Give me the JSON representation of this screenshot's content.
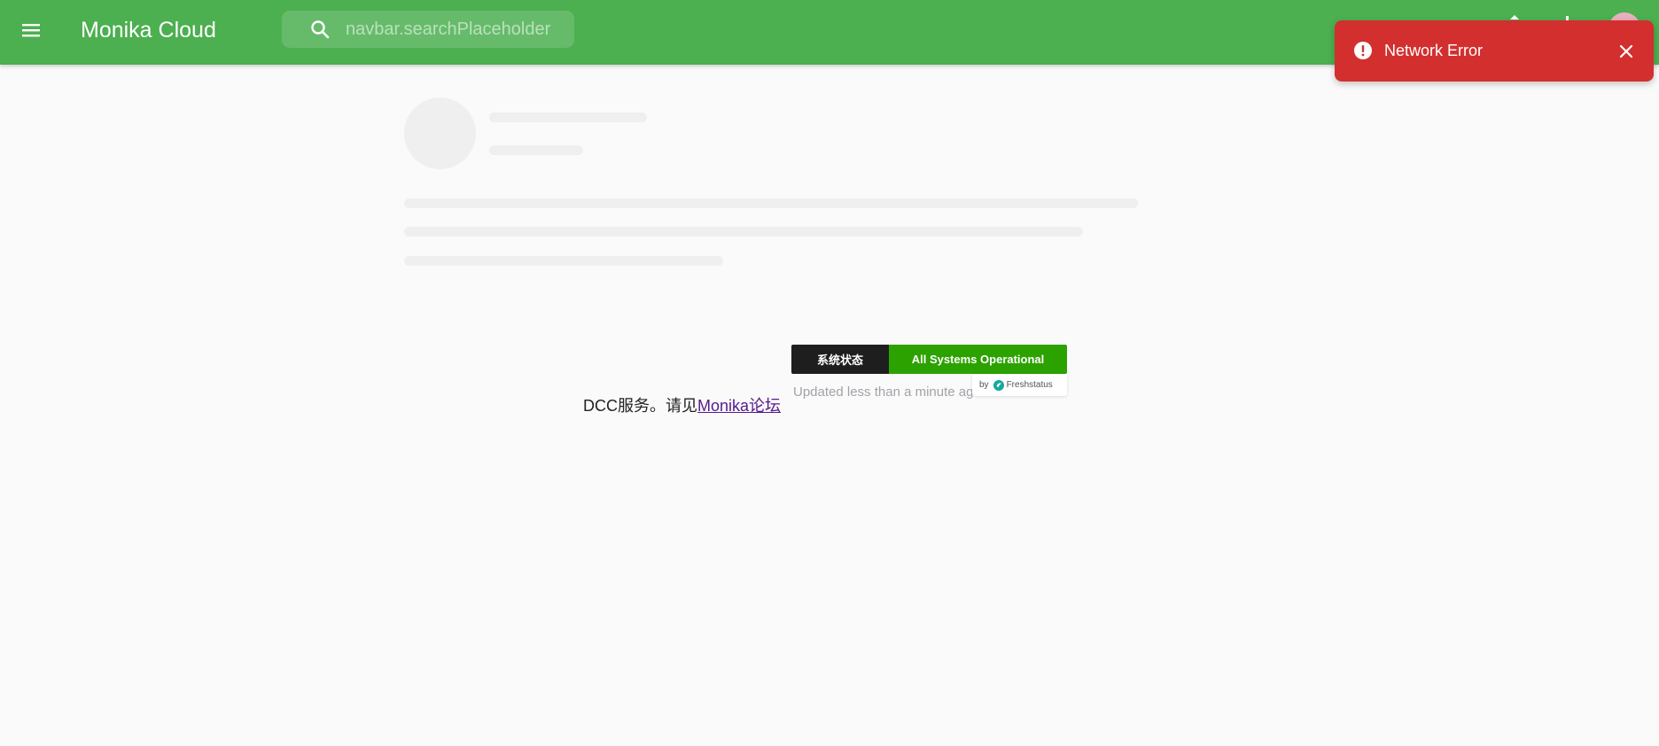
{
  "navbar": {
    "app_title": "Monika Cloud",
    "search_placeholder": "navbar.searchPlaceholder",
    "menu_icon": "menu-icon",
    "search_icon": "search-icon",
    "background": "#4caf50"
  },
  "status_widget": {
    "label": "系统状态",
    "value": "All Systems Operational",
    "updated": "Updated less than a minute ago",
    "by": "by",
    "provider": "Freshstatus",
    "value_color": "#2ca200"
  },
  "body_text": {
    "prefix": "DCC服务。请见",
    "link_text": "Monika论坛"
  },
  "toast": {
    "message": "Network Error",
    "icon": "error-icon",
    "close_icon": "close-icon",
    "color": "#d32f2f"
  }
}
